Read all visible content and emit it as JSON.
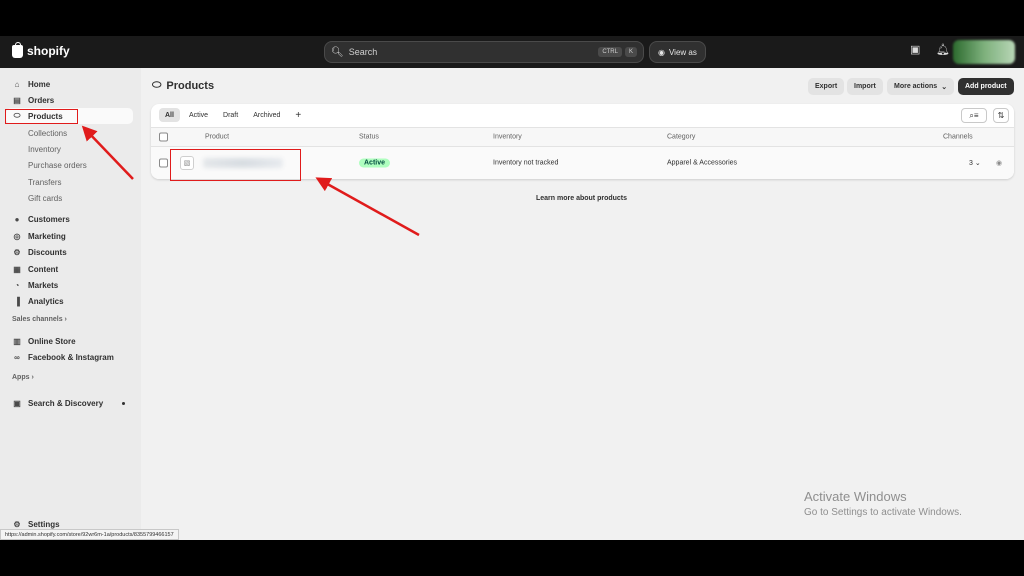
{
  "topbar": {
    "logo_text": "shopify",
    "search_placeholder": "Search",
    "shortcut_1": "CTRL",
    "shortcut_2": "K",
    "view_as_label": "View as"
  },
  "sidebar": {
    "items": [
      {
        "label": "Home",
        "icon": "home-icon"
      },
      {
        "label": "Orders",
        "icon": "inbox-icon"
      },
      {
        "label": "Products",
        "icon": "tag-icon"
      }
    ],
    "product_subitems": [
      "Collections",
      "Inventory",
      "Purchase orders",
      "Transfers",
      "Gift cards"
    ],
    "items2": [
      {
        "label": "Customers",
        "icon": "person-icon"
      },
      {
        "label": "Marketing",
        "icon": "target-icon"
      },
      {
        "label": "Discounts",
        "icon": "discount-icon"
      },
      {
        "label": "Content",
        "icon": "content-icon"
      },
      {
        "label": "Markets",
        "icon": "globe-icon"
      },
      {
        "label": "Analytics",
        "icon": "bar-chart-icon"
      }
    ],
    "sales_channels_label": "Sales channels",
    "channels": [
      {
        "label": "Online Store",
        "icon": "store-icon"
      },
      {
        "label": "Facebook & Instagram",
        "icon": "meta-icon"
      }
    ],
    "apps_label": "Apps",
    "apps": [
      {
        "label": "Search & Discovery",
        "icon": "search-discovery-icon"
      }
    ],
    "settings_label": "Settings"
  },
  "main": {
    "title": "Products",
    "buttons": {
      "export": "Export",
      "import": "Import",
      "more_actions": "More actions",
      "add_product": "Add product"
    },
    "tabs": [
      "All",
      "Active",
      "Draft",
      "Archived"
    ],
    "selected_tab": "All",
    "columns": [
      "Product",
      "Status",
      "Inventory",
      "Category",
      "Channels"
    ],
    "rows": [
      {
        "product": "",
        "status": "Active",
        "inventory": "Inventory not tracked",
        "category": "Apparel & Accessories",
        "channels": "3"
      }
    ],
    "learn_more": "Learn more about products"
  },
  "watermark": {
    "title": "Activate Windows",
    "subtitle": "Go to Settings to activate Windows."
  },
  "status_url": "https://admin.shopify.com/store/92wr6m-1a/products/8355799466157",
  "colors": {
    "topbar": "#1a1a1a",
    "annotation": "#e01b1b",
    "badge_bg": "#affebf",
    "primary_button": "#303030"
  }
}
